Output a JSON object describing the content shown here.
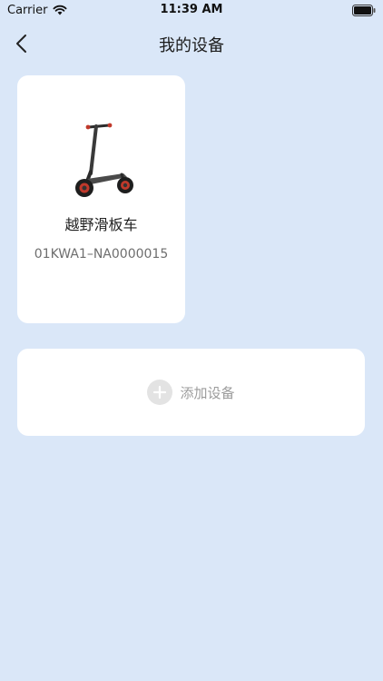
{
  "status_bar": {
    "carrier": "Carrier",
    "time": "11:39 AM"
  },
  "nav": {
    "title": "我的设备"
  },
  "devices": [
    {
      "name": "越野滑板车",
      "serial": "01KWA1–NA0000015",
      "image": "electric-scooter"
    }
  ],
  "add_device": {
    "label": "添加设备",
    "icon": "plus-circle-icon"
  },
  "colors": {
    "background": "#dae7f8",
    "card": "#ffffff",
    "muted_text": "#9b9b9b"
  }
}
